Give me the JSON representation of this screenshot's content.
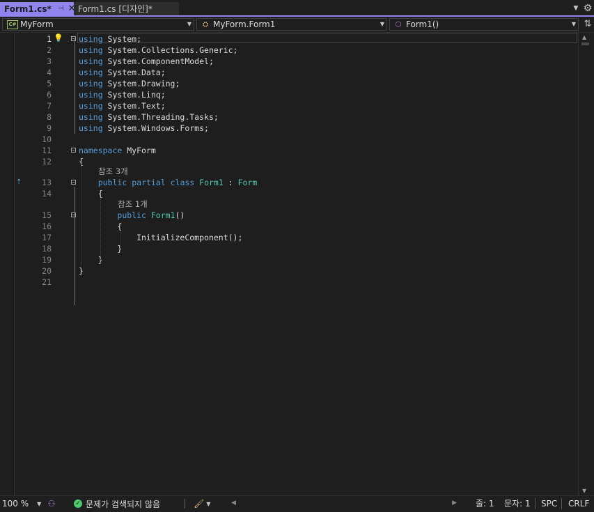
{
  "tabs": [
    {
      "label": "Form1.cs*",
      "active": true,
      "pin_icon": "pin-icon",
      "close_icon": "close-icon"
    },
    {
      "label": "Form1.cs [디자인]*",
      "active": false
    }
  ],
  "navbar": {
    "project": {
      "icon": "csharp-project-icon",
      "icon_text": "C#",
      "label": "MyForm"
    },
    "type": {
      "icon": "class-icon",
      "label": "MyForm.Form1"
    },
    "member": {
      "icon": "method-icon",
      "label": "Form1()"
    }
  },
  "editor": {
    "lines": [
      {
        "n": "1",
        "tokens": [
          [
            "kw",
            "using"
          ],
          [
            "t",
            " System;"
          ]
        ]
      },
      {
        "n": "2",
        "tokens": [
          [
            "kw",
            "using"
          ],
          [
            "t",
            " System.Collections.Generic;"
          ]
        ]
      },
      {
        "n": "3",
        "tokens": [
          [
            "kw",
            "using"
          ],
          [
            "t",
            " System.ComponentModel;"
          ]
        ]
      },
      {
        "n": "4",
        "tokens": [
          [
            "kw",
            "using"
          ],
          [
            "t",
            " System.Data;"
          ]
        ]
      },
      {
        "n": "5",
        "tokens": [
          [
            "kw",
            "using"
          ],
          [
            "t",
            " System.Drawing;"
          ]
        ]
      },
      {
        "n": "6",
        "tokens": [
          [
            "kw",
            "using"
          ],
          [
            "t",
            " System.Linq;"
          ]
        ]
      },
      {
        "n": "7",
        "tokens": [
          [
            "kw",
            "using"
          ],
          [
            "t",
            " System.Text;"
          ]
        ]
      },
      {
        "n": "8",
        "tokens": [
          [
            "kw",
            "using"
          ],
          [
            "t",
            " System.Threading.Tasks;"
          ]
        ]
      },
      {
        "n": "9",
        "tokens": [
          [
            "kw",
            "using"
          ],
          [
            "t",
            " System.Windows.Forms;"
          ]
        ]
      },
      {
        "n": "10",
        "tokens": []
      },
      {
        "n": "11",
        "tokens": [
          [
            "kw",
            "namespace"
          ],
          [
            "t",
            " MyForm"
          ]
        ]
      },
      {
        "n": "12",
        "tokens": [
          [
            "t",
            "{"
          ]
        ]
      },
      {
        "lens": "참조 3개"
      },
      {
        "n": "13",
        "tokens": [
          [
            "t",
            "    "
          ],
          [
            "kw",
            "public"
          ],
          [
            "t",
            " "
          ],
          [
            "kw",
            "partial"
          ],
          [
            "t",
            " "
          ],
          [
            "kw",
            "class"
          ],
          [
            "t",
            " "
          ],
          [
            "ty",
            "Form1"
          ],
          [
            "t",
            " : "
          ],
          [
            "ty",
            "Form"
          ]
        ]
      },
      {
        "n": "14",
        "tokens": [
          [
            "t",
            "    {"
          ]
        ]
      },
      {
        "lens": "참조 1개",
        "indent": 1
      },
      {
        "n": "15",
        "tokens": [
          [
            "t",
            "        "
          ],
          [
            "kw",
            "public"
          ],
          [
            "t",
            " "
          ],
          [
            "ty",
            "Form1"
          ],
          [
            "t",
            "()"
          ]
        ]
      },
      {
        "n": "16",
        "tokens": [
          [
            "t",
            "        {"
          ]
        ]
      },
      {
        "n": "17",
        "tokens": [
          [
            "t",
            "            InitializeComponent();"
          ]
        ]
      },
      {
        "n": "18",
        "tokens": [
          [
            "t",
            "        }"
          ]
        ]
      },
      {
        "n": "19",
        "tokens": [
          [
            "t",
            "    }"
          ]
        ]
      },
      {
        "n": "20",
        "tokens": [
          [
            "t",
            "}"
          ]
        ]
      },
      {
        "n": "21",
        "tokens": []
      }
    ]
  },
  "statusbar": {
    "zoom": "100 %",
    "issues": "문제가 검색되지 않음",
    "line": "줄: 1",
    "column": "문자: 1",
    "whitespace": "SPC",
    "line_ending": "CRLF"
  },
  "colors": {
    "accent": "#9184ee",
    "keyword": "#569cd6",
    "type": "#4ec9b0",
    "background": "#1e1e1e"
  }
}
